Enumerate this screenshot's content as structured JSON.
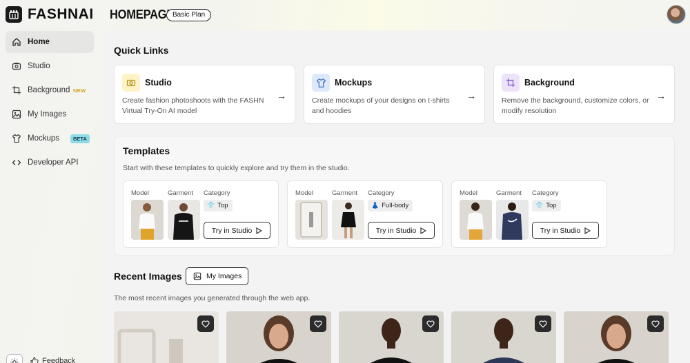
{
  "header": {
    "logo_text": "FASHNAI",
    "page_title": "HOMEPAGE",
    "plan_badge": "Basic Plan"
  },
  "sidebar": {
    "items": [
      {
        "label": "Home",
        "icon": "home-icon",
        "active": true
      },
      {
        "label": "Studio",
        "icon": "camera-icon"
      },
      {
        "label": "Background",
        "icon": "crop-icon",
        "tag": "NEW"
      },
      {
        "label": "My Images",
        "icon": "image-icon"
      },
      {
        "label": "Mockups",
        "icon": "shirt-icon",
        "tag": "BETA"
      },
      {
        "label": "Developer API",
        "icon": "code-icon"
      }
    ],
    "feedback_label": "Feedback"
  },
  "quick_links": {
    "title": "Quick Links",
    "cards": [
      {
        "title": "Studio",
        "desc": "Create fashion photoshoots with the FASHN Virtual Try-On AI model",
        "icon": "camera-icon",
        "color": "#fdf3c7"
      },
      {
        "title": "Mockups",
        "desc": "Create mockups of your designs on t-shirts and hoodies",
        "icon": "shirt-icon",
        "color": "#dde9fa"
      },
      {
        "title": "Background",
        "desc": "Remove the background, customize colors, or modify resolution",
        "icon": "crop-icon",
        "color": "#ece3fb"
      }
    ]
  },
  "templates": {
    "title": "Templates",
    "subtitle": "Start with these templates to quickly explore and try them in the studio.",
    "col_model": "Model",
    "col_garment": "Garment",
    "col_category": "Category",
    "try_label": "Try in Studio",
    "cards": [
      {
        "category": "Top",
        "category_icon": "tshirt-icon"
      },
      {
        "category": "Full-body",
        "category_icon": "dress-icon"
      },
      {
        "category": "Top",
        "category_icon": "tshirt-icon"
      }
    ]
  },
  "recent_images": {
    "title": "Recent Images",
    "button_label": "My Images",
    "subtitle": "The most recent images you generated through the web app."
  },
  "colors": {
    "accent_dark": "#1a1a1a",
    "beta_badge": "#8fdbe8",
    "new_tag": "#d6a321"
  }
}
